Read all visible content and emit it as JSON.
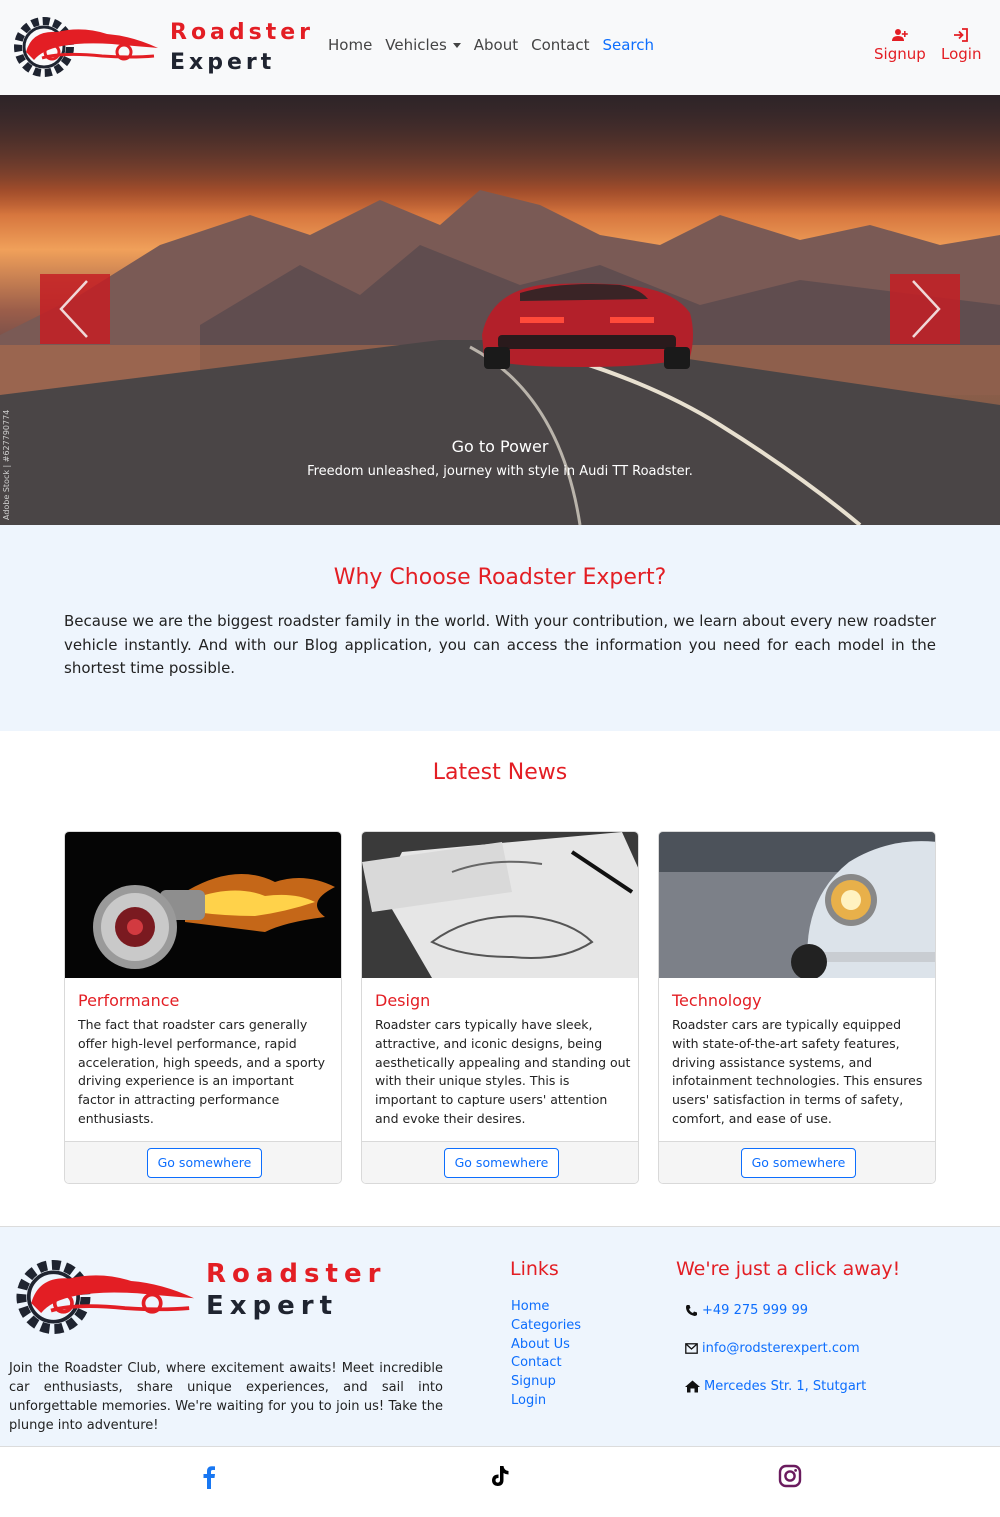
{
  "colors": {
    "brand_red": "#e31e24",
    "link_blue": "#0d6efd",
    "logo_navy": "#1f2430"
  },
  "brand": {
    "line1": "Roadster",
    "line2": "Expert"
  },
  "nav": {
    "home": "Home",
    "vehicles": "Vehicles",
    "about": "About",
    "contact": "Contact",
    "search": "Search",
    "signup": "Signup",
    "login": "Login"
  },
  "hero": {
    "title": "Go to Power",
    "subtitle": "Freedom unleashed, journey with style in Audi TT Roadster.",
    "watermark": "Adobe Stock | #627790774",
    "prev_icon": "chevron-left-icon",
    "next_icon": "chevron-right-icon"
  },
  "why": {
    "title": "Why Choose Roadster Expert?",
    "body": "Because we are the biggest roadster family in the world. With your contribution, we learn about every new roadster vehicle instantly. And with our Blog application, you can access the information you need for each model in the shortest time possible."
  },
  "news": {
    "title": "Latest News",
    "cards": [
      {
        "title": "Performance",
        "text": "The fact that roadster cars generally offer high-level performance, rapid acceleration, high speeds, and a sporty driving experience is an important factor in attracting performance enthusiasts.",
        "button": "Go somewhere"
      },
      {
        "title": "Design",
        "text": "Roadster cars typically have sleek, attractive, and iconic designs, being aesthetically appealing and standing out with their unique styles. This is important to capture users' attention and evoke their desires.",
        "button": "Go somewhere"
      },
      {
        "title": "Technology",
        "text": "Roadster cars are typically equipped with state-of-the-art safety features, driving assistance systems, and infotainment technologies. This ensures users' satisfaction in terms of safety, comfort, and ease of use.",
        "button": "Go somewhere"
      }
    ]
  },
  "footer": {
    "about": "Join the Roadster Club, where excitement awaits! Meet incredible car enthusiasts, share unique experiences, and sail into unforgettable memories. We're waiting for you to join us! Take the plunge into adventure!",
    "links_title": "Links",
    "links": [
      "Home",
      "Categories",
      "About Us",
      "Contact",
      "Signup",
      "Login"
    ],
    "contact_title": "We're just a click away!",
    "phone": "+49 275 999 99",
    "email": "info@rodsterexpert.com",
    "address": "Mercedes Str. 1, Stutgart"
  },
  "social": {
    "facebook": {
      "icon": "facebook-icon",
      "color": "#1877f2"
    },
    "tiktok": {
      "icon": "tiktok-icon",
      "color": "#000000"
    },
    "instagram": {
      "icon": "instagram-icon",
      "color": "#6a1b5e"
    }
  }
}
